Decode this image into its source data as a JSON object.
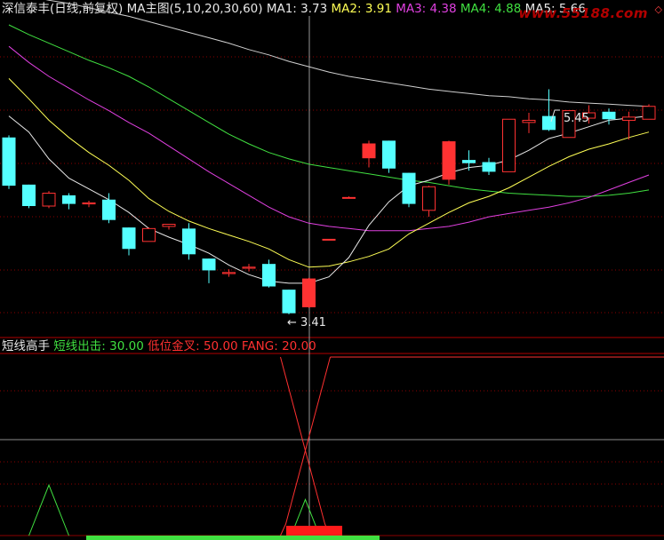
{
  "header": {
    "stock": "深信泰丰",
    "mode": "(日线,前复权)",
    "indicator": "MA主图",
    "params": "(5,10,20,30,60)",
    "ma": [
      {
        "label": "MA1:",
        "value": "3.73",
        "color": "#e8e8e8"
      },
      {
        "label": "MA2:",
        "value": "3.91",
        "color": "#ffff55"
      },
      {
        "label": "MA3:",
        "value": "4.38",
        "color": "#e040e0"
      },
      {
        "label": "MA4:",
        "value": "4.88",
        "color": "#40e040"
      },
      {
        "label": "MA5:",
        "value": "5.66",
        "color": "#e8e8e8"
      }
    ]
  },
  "sub_header": {
    "name": "短线高手",
    "items": [
      {
        "label": "短线出击:",
        "value": "30.00",
        "color": "#40e040"
      },
      {
        "label": "低位金叉:",
        "value": "50.00",
        "color": "#ff3030"
      },
      {
        "label": "FANG:",
        "value": "20.00",
        "color": "#ff3030"
      }
    ]
  },
  "watermark": "www.55188.com",
  "corner_icon": "diamond-icon",
  "colors": {
    "up": "#ff3232",
    "down": "#54ffff",
    "grid": "#8b0000",
    "ma1": "#e8e8e8",
    "ma2": "#ffff55",
    "ma3": "#e040e0",
    "ma4": "#40e040",
    "ma5": "#cfcfcf"
  },
  "chart_data": {
    "type": "candlestick",
    "price_range": [
      3.2,
      6.1
    ],
    "high_label": "5.45",
    "low_label": "3.41",
    "candles": [
      {
        "o": 5.0,
        "h": 5.02,
        "l": 4.52,
        "c": 4.55
      },
      {
        "o": 4.56,
        "h": 4.56,
        "l": 4.34,
        "c": 4.36
      },
      {
        "o": 4.36,
        "h": 4.5,
        "l": 4.34,
        "c": 4.48
      },
      {
        "o": 4.46,
        "h": 4.48,
        "l": 4.33,
        "c": 4.38
      },
      {
        "o": 4.38,
        "h": 4.41,
        "l": 4.35,
        "c": 4.39
      },
      {
        "o": 4.42,
        "h": 4.48,
        "l": 4.2,
        "c": 4.23
      },
      {
        "o": 4.16,
        "h": 4.16,
        "l": 3.9,
        "c": 3.96
      },
      {
        "o": 4.03,
        "h": 4.16,
        "l": 4.03,
        "c": 4.15
      },
      {
        "o": 4.17,
        "h": 4.19,
        "l": 4.14,
        "c": 4.19
      },
      {
        "o": 4.15,
        "h": 4.2,
        "l": 3.86,
        "c": 3.91
      },
      {
        "o": 3.87,
        "h": 3.87,
        "l": 3.64,
        "c": 3.76
      },
      {
        "o": 3.73,
        "h": 3.77,
        "l": 3.7,
        "c": 3.74
      },
      {
        "o": 3.78,
        "h": 3.82,
        "l": 3.75,
        "c": 3.79
      },
      {
        "o": 3.82,
        "h": 3.86,
        "l": 3.6,
        "c": 3.61
      },
      {
        "o": 3.58,
        "h": 3.58,
        "l": 3.35,
        "c": 3.36
      },
      {
        "o": 3.42,
        "h": 3.69,
        "l": 3.41,
        "c": 3.68
      },
      {
        "o": 4.05,
        "h": 4.05,
        "l": 4.05,
        "c": 4.05
      },
      {
        "o": 4.44,
        "h": 4.45,
        "l": 4.44,
        "c": 4.44
      },
      {
        "o": 4.81,
        "h": 4.97,
        "l": 4.72,
        "c": 4.94
      },
      {
        "o": 4.97,
        "h": 4.97,
        "l": 4.67,
        "c": 4.71
      },
      {
        "o": 4.67,
        "h": 4.67,
        "l": 4.35,
        "c": 4.38
      },
      {
        "o": 4.32,
        "h": 4.55,
        "l": 4.26,
        "c": 4.54
      },
      {
        "o": 4.61,
        "h": 4.97,
        "l": 4.56,
        "c": 4.96
      },
      {
        "o": 4.79,
        "h": 4.88,
        "l": 4.69,
        "c": 4.76
      },
      {
        "o": 4.77,
        "h": 4.81,
        "l": 4.65,
        "c": 4.68
      },
      {
        "o": 4.68,
        "h": 5.17,
        "l": 4.68,
        "c": 5.17
      },
      {
        "o": 5.14,
        "h": 5.23,
        "l": 5.04,
        "c": 5.16
      },
      {
        "o": 5.2,
        "h": 5.45,
        "l": 5.06,
        "c": 5.07
      },
      {
        "o": 5.0,
        "h": 5.25,
        "l": 5.0,
        "c": 5.25
      },
      {
        "o": 5.18,
        "h": 5.3,
        "l": 5.13,
        "c": 5.23
      },
      {
        "o": 5.24,
        "h": 5.27,
        "l": 5.12,
        "c": 5.17
      },
      {
        "o": 5.16,
        "h": 5.24,
        "l": 4.98,
        "c": 5.19
      },
      {
        "o": 5.17,
        "h": 5.31,
        "l": 5.17,
        "c": 5.29
      }
    ],
    "ma_lines": {
      "ma1": [
        5.2,
        5.05,
        4.8,
        4.62,
        4.52,
        4.42,
        4.3,
        4.15,
        4.07,
        4.0,
        3.92,
        3.81,
        3.72,
        3.66,
        3.64,
        3.64,
        3.7,
        3.88,
        4.18,
        4.4,
        4.55,
        4.6,
        4.67,
        4.72,
        4.74,
        4.79,
        4.88,
        4.99,
        5.04,
        5.1,
        5.16,
        5.18,
        5.2
      ],
      "ma2": [
        5.55,
        5.36,
        5.16,
        5.0,
        4.86,
        4.74,
        4.6,
        4.43,
        4.31,
        4.22,
        4.15,
        4.09,
        4.03,
        3.96,
        3.86,
        3.79,
        3.8,
        3.84,
        3.89,
        3.96,
        4.1,
        4.2,
        4.3,
        4.39,
        4.45,
        4.53,
        4.63,
        4.73,
        4.82,
        4.89,
        4.94,
        5.0,
        5.05
      ],
      "ma3": [
        5.85,
        5.7,
        5.57,
        5.46,
        5.35,
        5.25,
        5.14,
        5.04,
        4.92,
        4.8,
        4.68,
        4.57,
        4.46,
        4.35,
        4.26,
        4.2,
        4.17,
        4.15,
        4.13,
        4.13,
        4.13,
        4.15,
        4.17,
        4.21,
        4.26,
        4.29,
        4.32,
        4.35,
        4.39,
        4.44,
        4.51,
        4.58,
        4.65
      ],
      "ma4": [
        6.05,
        5.96,
        5.88,
        5.8,
        5.72,
        5.65,
        5.57,
        5.47,
        5.36,
        5.25,
        5.14,
        5.03,
        4.94,
        4.86,
        4.8,
        4.75,
        4.72,
        4.69,
        4.66,
        4.63,
        4.6,
        4.58,
        4.55,
        4.52,
        4.5,
        4.48,
        4.47,
        4.46,
        4.45,
        4.45,
        4.46,
        4.48,
        4.51
      ],
      "ma5": [
        6.35,
        6.32,
        6.28,
        6.25,
        6.21,
        6.17,
        6.13,
        6.08,
        6.03,
        5.98,
        5.93,
        5.88,
        5.82,
        5.77,
        5.71,
        5.66,
        5.61,
        5.57,
        5.54,
        5.51,
        5.48,
        5.45,
        5.43,
        5.41,
        5.39,
        5.38,
        5.36,
        5.35,
        5.33,
        5.32,
        5.31,
        5.3,
        5.29
      ]
    },
    "indicator": {
      "range": [
        0,
        100
      ],
      "series": [
        {
          "name": "短线出击",
          "color": "#40e040",
          "value": 30.0
        },
        {
          "name": "低位金叉",
          "color": "#ff3030",
          "value": 50.0
        },
        {
          "name": "FANG",
          "color": "#ff3030",
          "value": 20.0
        }
      ],
      "spike_index": 2,
      "spike_value": 50,
      "cross_index": 15,
      "green_bar": [
        4,
        18
      ],
      "red_bar": [
        14,
        16
      ]
    }
  }
}
